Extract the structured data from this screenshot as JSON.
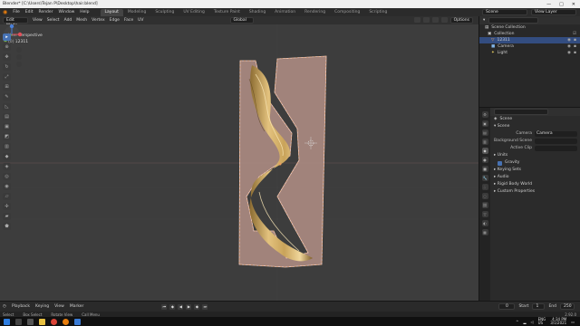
{
  "window": {
    "title": "Blender* [C:\\Users\\Tejan P\\Desktop\\hair.blend]",
    "min": "—",
    "max": "□",
    "close": "✕"
  },
  "menu": {
    "items": [
      "File",
      "Edit",
      "Render",
      "Window",
      "Help"
    ]
  },
  "workspaces": [
    "Layout",
    "Modeling",
    "Sculpting",
    "UV Editing",
    "Texture Paint",
    "Shading",
    "Animation",
    "Rendering",
    "Compositing",
    "Scripting"
  ],
  "active_workspace": "Layout",
  "topbar_right": {
    "scene": "Scene",
    "view_layer": "View Layer"
  },
  "header3d": {
    "mode": "Edit Mode",
    "menus": [
      "View",
      "Select",
      "Add",
      "Mesh",
      "Vertex",
      "Edge",
      "Face",
      "UV"
    ],
    "orientation": "Global",
    "options": "Options"
  },
  "viewport": {
    "info_line1": "User Perspective",
    "info_line2": "(0) 12311"
  },
  "outliner": {
    "title": "Scene Collection",
    "rows": [
      {
        "label": "Collection",
        "indent": 0,
        "selected": false
      },
      {
        "label": "12311",
        "indent": 1,
        "selected": true
      },
      {
        "label": "Camera",
        "indent": 1,
        "selected": false
      },
      {
        "label": "Light",
        "indent": 1,
        "selected": false
      }
    ]
  },
  "properties": {
    "header": "Scene",
    "section_scene": "Scene",
    "camera_label": "Camera",
    "camera_value": "Camera",
    "bg_scene_label": "Background Scene",
    "active_clip_label": "Active Clip",
    "units": "Units",
    "gravity": "Gravity",
    "keying_sets": "Keying Sets",
    "audio": "Audio",
    "rigid_body_world": "Rigid Body World",
    "custom_properties": "Custom Properties"
  },
  "timeline": {
    "menus": [
      "Playback",
      "Keying",
      "View",
      "Marker"
    ],
    "current_frame": "0",
    "start_label": "Start",
    "start": "1",
    "end_label": "End",
    "end": "250"
  },
  "statusbar": {
    "select": "Select",
    "box_select": "Box Select",
    "rotate_view": "Rotate View",
    "call_menu": "Call Menu",
    "version": "2.92.0"
  },
  "taskbar": {
    "time": "4:34 PM",
    "date": "3/1/2021",
    "lang": "ENG\nUS"
  },
  "colors": {
    "accent": "#4772b3",
    "selection": "#334d80",
    "mesh_face": "#b38f86",
    "hair": "#c9a35a"
  }
}
